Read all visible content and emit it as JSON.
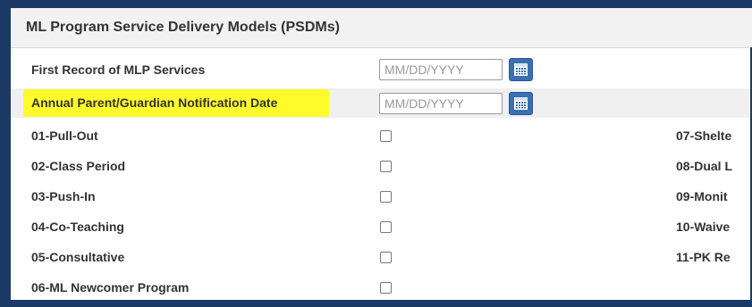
{
  "section": {
    "title": "ML Program Service Delivery Models (PSDMs)"
  },
  "date_fields": [
    {
      "label": "First Record of MLP Services",
      "placeholder": "MM/DD/YYYY",
      "calendar_icon": "calendar-icon"
    },
    {
      "label": "Annual Parent/Guardian Notification Date",
      "placeholder": "MM/DD/YYYY",
      "calendar_icon": "calendar-icon",
      "highlight_color": "#fffb2a"
    }
  ],
  "models_left": [
    {
      "label": "01-Pull-Out",
      "checked": false
    },
    {
      "label": "02-Class Period",
      "checked": false
    },
    {
      "label": "03-Push-In",
      "checked": false
    },
    {
      "label": "04-Co-Teaching",
      "checked": false
    },
    {
      "label": "05-Consultative",
      "checked": false
    },
    {
      "label": "06-ML Newcomer Program",
      "checked": false
    }
  ],
  "models_right": [
    {
      "label": "07-Shelte"
    },
    {
      "label": "08-Dual L"
    },
    {
      "label": "09-Monit"
    },
    {
      "label": "10-Waive"
    },
    {
      "label": "11-PK Re"
    }
  ],
  "colors": {
    "frame": "#1b3a66",
    "calendar_button": "#3a6fb0",
    "highlight": "#fffb2a"
  }
}
